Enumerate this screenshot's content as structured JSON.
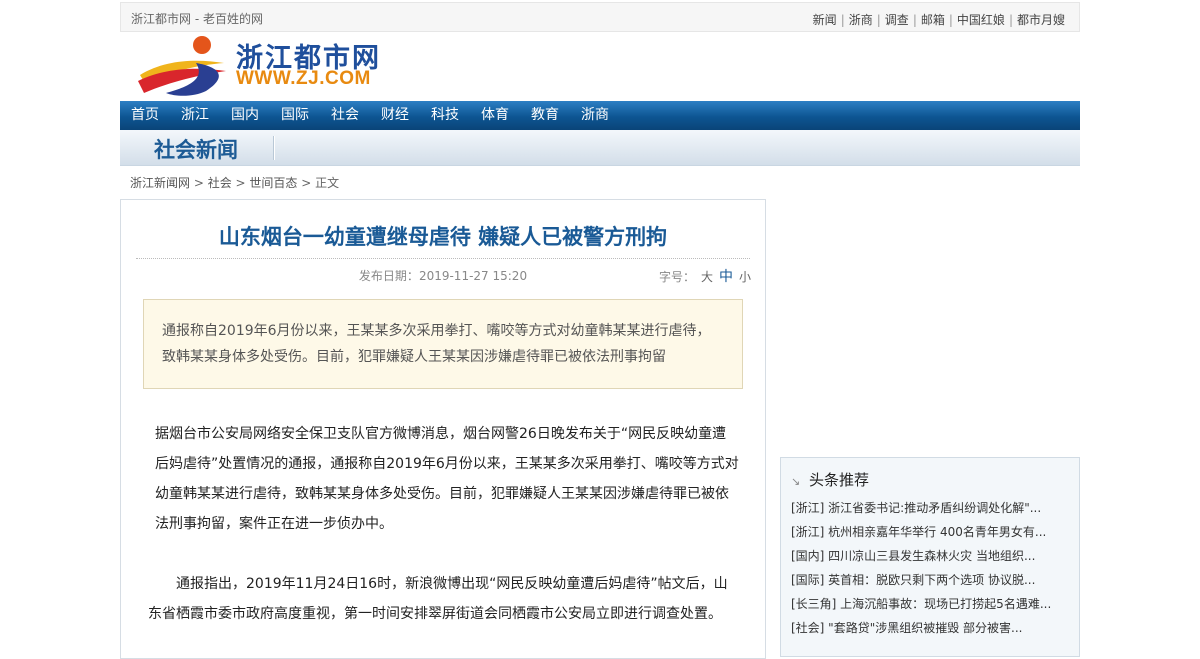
{
  "topbar": {
    "tagline": "浙江都市网 - 老百姓的网",
    "links": [
      "新闻",
      "浙商",
      "调查",
      "邮箱",
      "中国红娘",
      "都市月嫂"
    ]
  },
  "logo": {
    "cn": "浙江都市网",
    "en": "WWW.ZJ.COM"
  },
  "nav": [
    "首页",
    "浙江",
    "国内",
    "国际",
    "社会",
    "财经",
    "科技",
    "体育",
    "教育",
    "浙商"
  ],
  "section": {
    "title": "社会新闻"
  },
  "breadcrumb": {
    "items": [
      "浙江新闻网",
      "社会",
      "世间百态",
      "正文"
    ],
    "sep": " > "
  },
  "article": {
    "title": "山东烟台一幼童遭继母虐待 嫌疑人已被警方刑拘",
    "date_label": "发布日期：",
    "date": "2019-11-27 15:20",
    "fontsize_label": "字号：",
    "fontsize_options": [
      "大",
      "中",
      "小"
    ],
    "summary": "通报称自2019年6月份以来，王某某多次采用拳打、嘴咬等方式对幼童韩某某进行虐待，致韩某某身体多处受伤。目前，犯罪嫌疑人王某某因涉嫌虐待罪已被依法刑事拘留",
    "paragraphs": [
      "据烟台市公安局网络安全保卫支队官方微博消息，烟台网警26日晚发布关于“网民反映幼童遭后妈虐待”处置情况的通报，通报称自2019年6月份以来，王某某多次采用拳打、嘴咬等方式对幼童韩某某进行虐待，致韩某某身体多处受伤。目前，犯罪嫌疑人王某某因涉嫌虐待罪已被依法刑事拘留，案件正在进一步侦办中。",
      "通报指出，2019年11月24日16时，新浪微博出现“网民反映幼童遭后妈虐待”帖文后，山东省栖霞市委市政府高度重视，第一时间安排翠屏街道会同栖霞市公安局立即进行调查处置。"
    ]
  },
  "sidebar": {
    "title": "头条推荐",
    "items": [
      "[浙江] 浙江省委书记:推动矛盾纠纷调处化解\"...",
      "[浙江] 杭州相亲嘉年华举行 400名青年男女有...",
      "[国内] 四川凉山三县发生森林火灾 当地组织...",
      "[国际] 英首相：脱欧只剩下两个选项 协议脱...",
      "[长三角] 上海沉船事故：现场已打捞起5名遇难...",
      "[社会] \"套路贷\"涉黑组织被摧毁 部分被害..."
    ]
  },
  "colors": {
    "brand_blue": "#1a5a96",
    "brand_orange": "#e88a10",
    "nav_bg": "#0d5592"
  }
}
